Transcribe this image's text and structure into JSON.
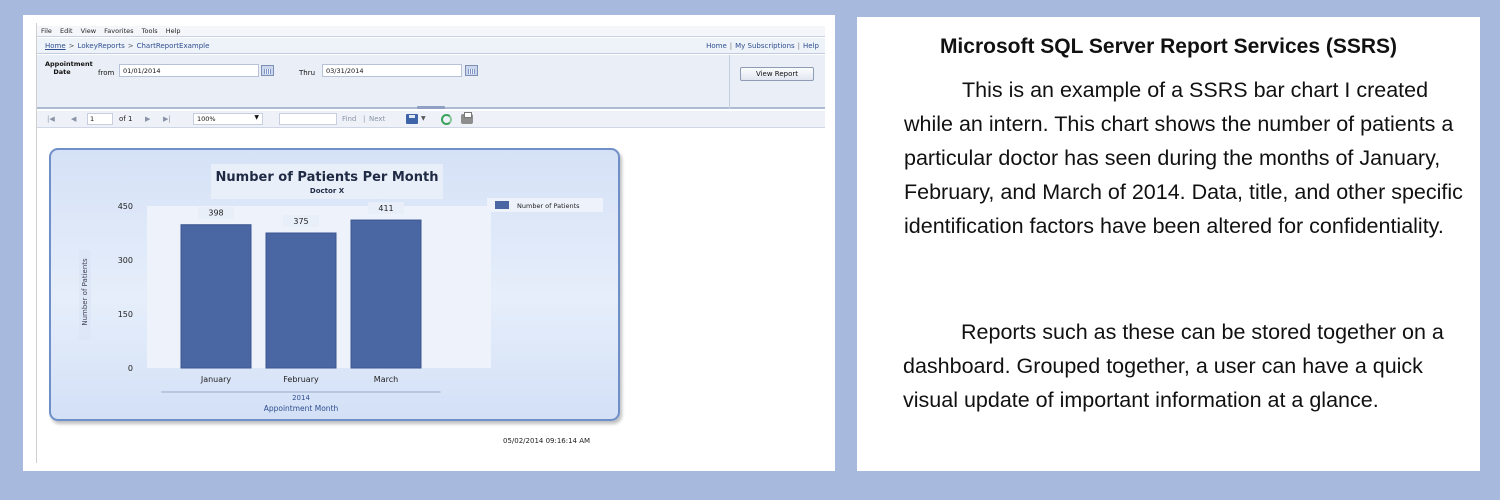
{
  "browser": {
    "menu": [
      "File",
      "Edit",
      "View",
      "Favorites",
      "Tools",
      "Help"
    ]
  },
  "nav": {
    "breadcrumb": [
      "Home",
      "LokeyReports",
      "ChartReportExample"
    ],
    "breadcrumb_sep": ">",
    "links": [
      "Home",
      "My Subscriptions",
      "Help"
    ],
    "links_sep": "|"
  },
  "params": {
    "label": "Appointment Date",
    "from_label": "from",
    "from_value": "01/01/2014",
    "thru_label": "Thru",
    "thru_value": "03/31/2014",
    "view_report": "View Report"
  },
  "toolbar": {
    "first": "|◀",
    "prev": "◀",
    "page": "1",
    "of_pages": "of 1",
    "next": "▶",
    "last": "▶|",
    "zoom": "100%",
    "find": "Find",
    "sep": "|",
    "next_link": "Next"
  },
  "chart_data": {
    "type": "bar",
    "title": "Number of Patients Per Month",
    "subtitle": "Doctor X",
    "categories": [
      "January",
      "February",
      "March"
    ],
    "series": [
      {
        "name": "Number of Patients",
        "values": [
          398,
          375,
          411
        ],
        "color": "#4a66a3"
      }
    ],
    "ylabel": "Number of Patients",
    "yticks": [
      0,
      150,
      300,
      450
    ],
    "ylim": [
      0,
      450
    ],
    "xgroup_label": "2014",
    "xlabel": "Appointment  Month",
    "legend_position": "top-right",
    "grid": false
  },
  "timestamp": "05/02/2014 09:16:14 AM",
  "description": {
    "title": "Microsoft SQL Server Report Services (SSRS)",
    "paragraphs": [
      "This is an example of a SSRS bar chart I created while an intern. This chart shows the number of patients a particular doctor has seen during the months of January, February, and March of 2014. Data, title, and other specific identification factors have been altered for confidentiality.",
      "Reports such as these can be stored together on a dashboard. Grouped together, a user can have a quick visual update of important information at a glance."
    ]
  },
  "colors": {
    "page_background": "#a8b9de",
    "bar": "#4a66a3",
    "chart_border": "#6f8fc9"
  }
}
